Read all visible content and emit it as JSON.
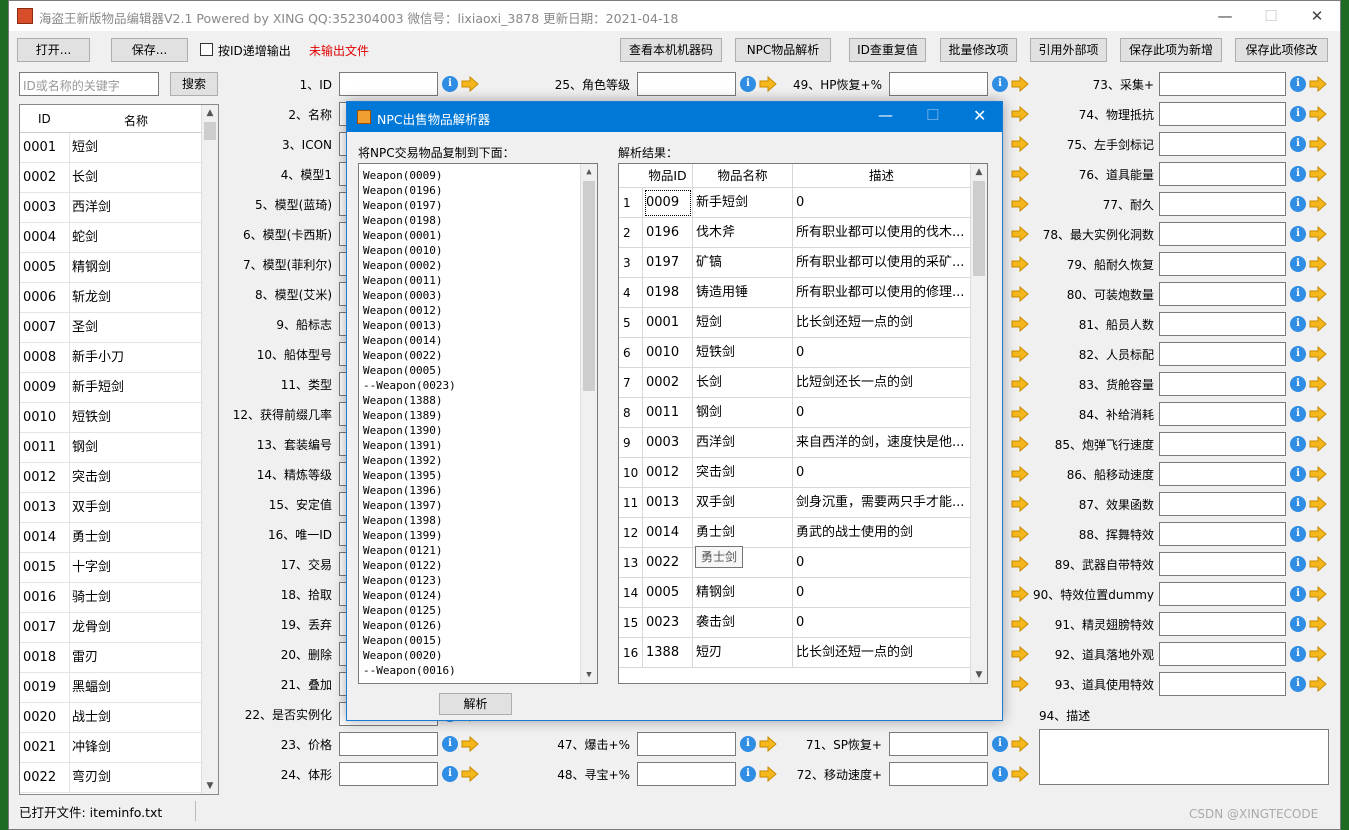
{
  "window": {
    "title": "海盗王新版物品编辑器V2.1 Powered by XING QQ:352304003 微信号：lixiaoxi_3878 更新日期：2021-04-18",
    "minimize": "—",
    "maximize": "☐",
    "close": "✕"
  },
  "toolbar": {
    "open": "打开...",
    "save": "保存...",
    "id_increment_label": "按ID递增输出",
    "unsaved": "未输出文件",
    "view_machine_code": "查看本机机器码",
    "npc_parse": "NPC物品解析",
    "id_duplicate": "ID查重复值",
    "batch_modify": "批量修改项",
    "reference_external": "引用外部项",
    "save_as_new": "保存此项为新增",
    "save_modify": "保存此项修改"
  },
  "search": {
    "placeholder": "ID或名称的关键字",
    "button": "搜索"
  },
  "item_list": {
    "col_id": "ID",
    "col_name": "名称",
    "rows": [
      {
        "id": "0001",
        "name": "短剑"
      },
      {
        "id": "0002",
        "name": "长剑"
      },
      {
        "id": "0003",
        "name": "西洋剑"
      },
      {
        "id": "0004",
        "name": "蛇剑"
      },
      {
        "id": "0005",
        "name": "精钢剑"
      },
      {
        "id": "0006",
        "name": "斩龙剑"
      },
      {
        "id": "0007",
        "name": "圣剑"
      },
      {
        "id": "0008",
        "name": "新手小刀"
      },
      {
        "id": "0009",
        "name": "新手短剑"
      },
      {
        "id": "0010",
        "name": "短铁剑"
      },
      {
        "id": "0011",
        "name": "钢剑"
      },
      {
        "id": "0012",
        "name": "突击剑"
      },
      {
        "id": "0013",
        "name": "双手剑"
      },
      {
        "id": "0014",
        "name": "勇士剑"
      },
      {
        "id": "0015",
        "name": "十字剑"
      },
      {
        "id": "0016",
        "name": "骑士剑"
      },
      {
        "id": "0017",
        "name": "龙骨剑"
      },
      {
        "id": "0018",
        "name": "雷刃"
      },
      {
        "id": "0019",
        "name": "黑蝠剑"
      },
      {
        "id": "0020",
        "name": "战士剑"
      },
      {
        "id": "0021",
        "name": "冲锋剑"
      },
      {
        "id": "0022",
        "name": "弯刃剑"
      }
    ]
  },
  "status": "已打开文件: iteminfo.txt",
  "fields": {
    "col1": [
      "1、ID",
      "2、名称",
      "3、ICON",
      "4、模型1",
      "5、模型(蓝琦)",
      "6、模型(卡西斯)",
      "7、模型(菲利尔)",
      "8、模型(艾米)",
      "9、船标志",
      "10、船体型号",
      "11、类型",
      "12、获得前缀几率",
      "13、套装编号",
      "14、精炼等级",
      "15、安定值",
      "16、唯一ID",
      "17、交易",
      "18、拾取",
      "19、丢弃",
      "20、删除",
      "21、叠加",
      "22、是否实例化",
      "23、价格",
      "24、体形"
    ],
    "col2_top": "25、角色等级",
    "col2_bottom": [
      "47、爆击+%",
      "48、寻宝+%"
    ],
    "col3_top": "49、HP恢复+%",
    "col3_bottom": [
      "71、SP恢复+",
      "72、移动速度+"
    ],
    "col4": [
      "73、采集+",
      "74、物理抵抗",
      "75、左手剑标记",
      "76、道具能量",
      "77、耐久",
      "78、最大实例化洞数",
      "79、船耐久恢复",
      "80、可装炮数量",
      "81、船员人数",
      "82、人员标配",
      "83、货舱容量",
      "84、补给消耗",
      "85、炮弹飞行速度",
      "86、船移动速度",
      "87、效果函数",
      "88、挥舞特效",
      "89、武器自带特效",
      "90、特效位置dummy",
      "91、精灵翅膀特效",
      "92、道具落地外观",
      "93、道具使用特效"
    ],
    "description_label": "94、描述"
  },
  "dialog": {
    "title": "NPC出售物品解析器",
    "left_label": "将NPC交易物品复制到下面：",
    "right_label": "解析结果：",
    "parse_button": "解析",
    "lines": [
      "Weapon(0009)",
      "Weapon(0196)",
      "Weapon(0197)",
      "Weapon(0198)",
      "Weapon(0001)",
      "Weapon(0010)",
      "Weapon(0002)",
      "Weapon(0011)",
      "Weapon(0003)",
      "Weapon(0012)",
      "Weapon(0013)",
      "Weapon(0014)",
      "Weapon(0022)",
      "Weapon(0005)",
      "--Weapon(0023)",
      "Weapon(1388)",
      "Weapon(1389)",
      "Weapon(1390)",
      "Weapon(1391)",
      "Weapon(1392)",
      "Weapon(1395)",
      "Weapon(1396)",
      "Weapon(1397)",
      "Weapon(1398)",
      "Weapon(1399)",
      "Weapon(0121)",
      "Weapon(0122)",
      "Weapon(0123)",
      "Weapon(0124)",
      "Weapon(0125)",
      "Weapon(0126)",
      "Weapon(0015)",
      "Weapon(0020)",
      "--Weapon(0016)"
    ],
    "grid_headers": [
      "物品ID",
      "物品名称",
      "描述"
    ],
    "grid_rows": [
      {
        "n": "1",
        "id": "0009",
        "name": "新手短剑",
        "desc": "0"
      },
      {
        "n": "2",
        "id": "0196",
        "name": "伐木斧",
        "desc": "所有职业都可以使用的伐木..."
      },
      {
        "n": "3",
        "id": "0197",
        "name": "矿镐",
        "desc": "所有职业都可以使用的采矿..."
      },
      {
        "n": "4",
        "id": "0198",
        "name": "铸造用锤",
        "desc": "所有职业都可以使用的修理..."
      },
      {
        "n": "5",
        "id": "0001",
        "name": "短剑",
        "desc": "比长剑还短一点的剑"
      },
      {
        "n": "6",
        "id": "0010",
        "name": "短铁剑",
        "desc": "0"
      },
      {
        "n": "7",
        "id": "0002",
        "name": "长剑",
        "desc": "比短剑还长一点的剑"
      },
      {
        "n": "8",
        "id": "0011",
        "name": "钢剑",
        "desc": "0"
      },
      {
        "n": "9",
        "id": "0003",
        "name": "西洋剑",
        "desc": "来自西洋的剑，速度快是他..."
      },
      {
        "n": "10",
        "id": "0012",
        "name": "突击剑",
        "desc": "0"
      },
      {
        "n": "11",
        "id": "0013",
        "name": "双手剑",
        "desc": "剑身沉重，需要两只手才能..."
      },
      {
        "n": "12",
        "id": "0014",
        "name": "勇士剑",
        "desc": "勇武的战士使用的剑"
      },
      {
        "n": "13",
        "id": "0022",
        "name": "弯刃剑",
        "desc": "0"
      },
      {
        "n": "14",
        "id": "0005",
        "name": "精钢剑",
        "desc": "0"
      },
      {
        "n": "15",
        "id": "0023",
        "name": "袭击剑",
        "desc": "0"
      },
      {
        "n": "16",
        "id": "1388",
        "name": "短刃",
        "desc": "比长剑还短一点的剑"
      }
    ],
    "tooltip": "勇士剑"
  },
  "watermark": "CSDN @XINGTECODE"
}
